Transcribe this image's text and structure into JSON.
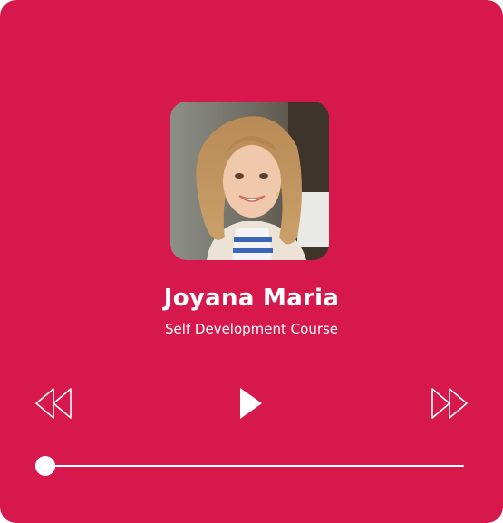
{
  "player": {
    "name": "Joyana Maria",
    "subtitle": "Self Development Course",
    "avatar_alt": "Portrait of a smiling woman with wavy blonde hair",
    "progress": 0.0,
    "colors": {
      "background": "#d7184d",
      "foreground": "#ffffff"
    },
    "controls": {
      "rewind_icon": "rewind-icon",
      "play_icon": "play-icon",
      "forward_icon": "fast-forward-icon"
    }
  }
}
